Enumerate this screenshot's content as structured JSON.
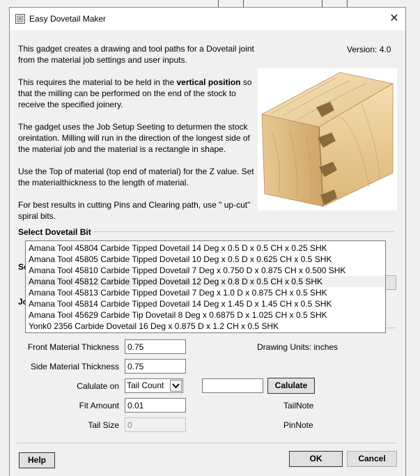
{
  "window": {
    "title": "Easy Dovetail Maker",
    "version": "Version: 4.0"
  },
  "intro": {
    "p1": "This gadget creates a drawing and tool paths for a Dovetail joint from the material job settings and user inputs.",
    "p2_before": "This requires the material to be held in the ",
    "p2_bold": "vertical position",
    "p2_after": " so that the milling can be performed on the end of the stock to receive the specified joinery.",
    "p3": "The gadget uses the Job Setup Seeting to deturmen the stock oreintation. Milling will run in the direction of the longest side of the material job and the material is a rectangle in shape.",
    "p4": "Use the Top of material (top end of material) for the Z value. Set the materialthickness to the length of material.",
    "p5": "For best results in cutting Pins and Clearing path, use \" up-cut\" spiral bits."
  },
  "bit_section": {
    "heading": "Select Dovetail Bit",
    "hidden_label_1": "Se",
    "hidden_label_2": "Jo",
    "selected_index": 3,
    "options": [
      "Amana Tool 45804 Carbide Tipped Dovetail 14 Deg x 0.5 D x 0.5 CH x 0.25 SHK",
      "Amana Tool 45805 Carbide Tipped Dovetail 10 Deg x 0.5 D x 0.625 CH x 0.5 SHK",
      "Amana Tool 45810 Carbide Tipped Dovetail 7 Deg x 0.750 D x 0.875 CH x 0.500 SHK",
      "Amana Tool 45812 Carbide Tipped Dovetail 12 Deg x 0.8 D x 0.5 CH x 0.5 SHK",
      "Amana Tool 45813 Carbide Tipped Dovetail 7 Deg x 1.0 D x 0.875 CH x 0.5 SHK",
      "Amana Tool 45814 Carbide Tipped Dovetail 14 Deg x 1.45 D x 1.45 CH x 0.5 SHK",
      "Amana Tool 45629 Carbide Tip Dovetail 8 Deg x 0.6875 D x 1.025 CH x 0.5 SHK",
      "Yonk0 2356 Carbide Dovetail 16 Deg x 0.875 D x 1.2 CH x 0.5 SHK"
    ]
  },
  "form": {
    "front_label": "Front Material Thickness",
    "front_value": "0.75",
    "side_label": "Side Material Thickness",
    "side_value": "0.75",
    "drawing_units": "Drawing Units: inches",
    "calc_on_label": "Calulate on",
    "calc_on_value": "Tail Count",
    "calc_input_value": "",
    "calculate_button": "Calulate",
    "fit_label": "Fit Amount",
    "fit_value": "0.01",
    "tail_note": "TailNote",
    "tail_size_label": "Tail Size",
    "tail_size_value": "0",
    "pin_note": "PinNote"
  },
  "footer": {
    "help": "Help",
    "ok": "OK",
    "cancel": "Cancel"
  },
  "colors": {
    "window_bg": "#f0f0f0",
    "wood_light": "#f3ddb0",
    "wood_mid": "#e4c48c",
    "wood_dark": "#c99e61"
  }
}
